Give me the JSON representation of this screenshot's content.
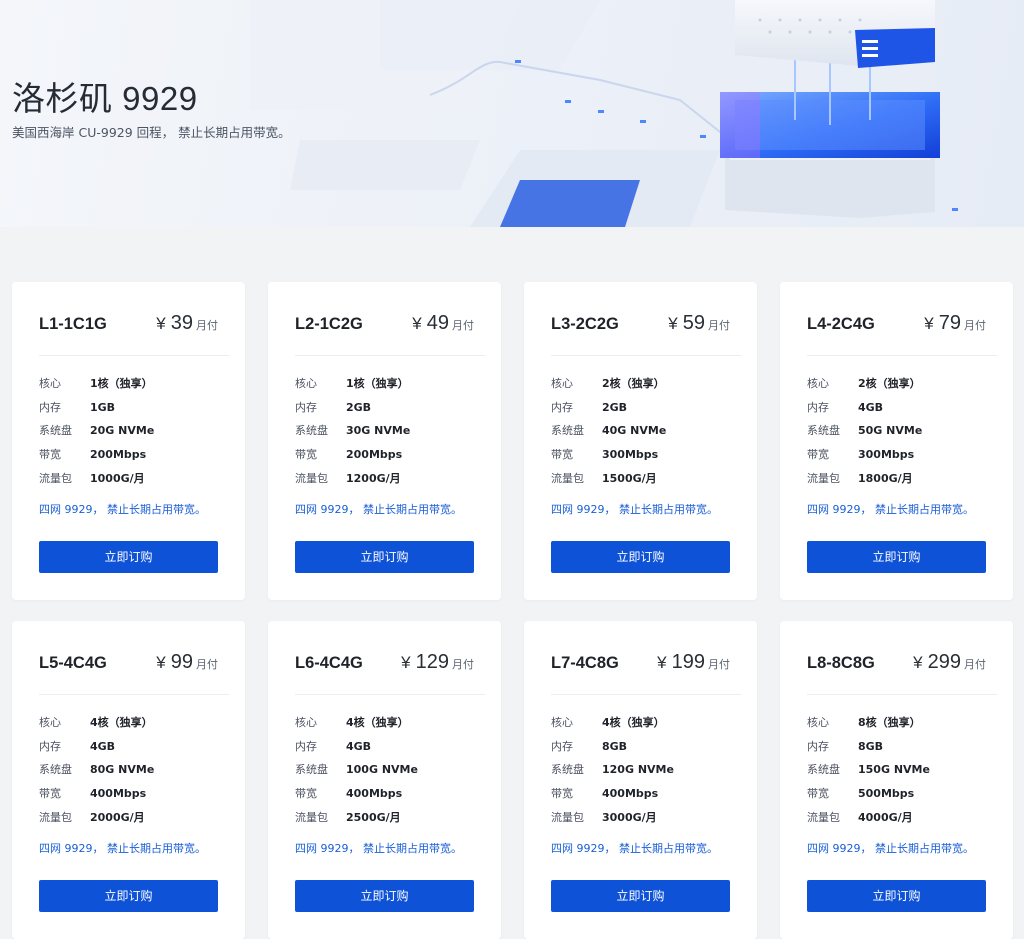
{
  "hero": {
    "title": "洛杉矶 9929",
    "subtitle": "美国西海岸 CU-9929 回程， 禁止长期占用带宽。"
  },
  "colors": {
    "accent": "#0e52d8",
    "note_link": "#1a5fd6",
    "page_bg": "#f2f3f5",
    "card_bg": "#ffffff"
  },
  "spec_labels": {
    "cores": "核心",
    "memory": "内存",
    "disk": "系统盘",
    "bandwidth": "带宽",
    "traffic": "流量包"
  },
  "plans": [
    {
      "name": "L1-1C1G",
      "currency": "¥",
      "price": "39",
      "period": "月付",
      "cores": "1核（独享）",
      "memory": "1GB",
      "disk": "20G NVMe",
      "bandwidth": "200Mbps",
      "traffic": "1000G/月",
      "note": "四网 9929， 禁止长期占用带宽。",
      "button": "立即订购"
    },
    {
      "name": "L2-1C2G",
      "currency": "¥",
      "price": "49",
      "period": "月付",
      "cores": "1核（独享）",
      "memory": "2GB",
      "disk": "30G NVMe",
      "bandwidth": "200Mbps",
      "traffic": "1200G/月",
      "note": "四网 9929， 禁止长期占用带宽。",
      "button": "立即订购"
    },
    {
      "name": "L3-2C2G",
      "currency": "¥",
      "price": "59",
      "period": "月付",
      "cores": "2核（独享）",
      "memory": "2GB",
      "disk": "40G NVMe",
      "bandwidth": "300Mbps",
      "traffic": "1500G/月",
      "note": "四网 9929， 禁止长期占用带宽。",
      "button": "立即订购"
    },
    {
      "name": "L4-2C4G",
      "currency": "¥",
      "price": "79",
      "period": "月付",
      "cores": "2核（独享）",
      "memory": "4GB",
      "disk": "50G NVMe",
      "bandwidth": "300Mbps",
      "traffic": "1800G/月",
      "note": "四网 9929， 禁止长期占用带宽。",
      "button": "立即订购"
    },
    {
      "name": "L5-4C4G",
      "currency": "¥",
      "price": "99",
      "period": "月付",
      "cores": "4核（独享）",
      "memory": "4GB",
      "disk": "80G NVMe",
      "bandwidth": "400Mbps",
      "traffic": "2000G/月",
      "note": "四网 9929， 禁止长期占用带宽。",
      "button": "立即订购"
    },
    {
      "name": "L6-4C4G",
      "currency": "¥",
      "price": "129",
      "period": "月付",
      "cores": "4核（独享）",
      "memory": "4GB",
      "disk": "100G NVMe",
      "bandwidth": "400Mbps",
      "traffic": "2500G/月",
      "note": "四网 9929， 禁止长期占用带宽。",
      "button": "立即订购"
    },
    {
      "name": "L7-4C8G",
      "currency": "¥",
      "price": "199",
      "period": "月付",
      "cores": "4核（独享）",
      "memory": "8GB",
      "disk": "120G NVMe",
      "bandwidth": "400Mbps",
      "traffic": "3000G/月",
      "note": "四网 9929， 禁止长期占用带宽。",
      "button": "立即订购"
    },
    {
      "name": "L8-8C8G",
      "currency": "¥",
      "price": "299",
      "period": "月付",
      "cores": "8核（独享）",
      "memory": "8GB",
      "disk": "150G NVMe",
      "bandwidth": "500Mbps",
      "traffic": "4000G/月",
      "note": "四网 9929， 禁止长期占用带宽。",
      "button": "立即订购"
    }
  ]
}
